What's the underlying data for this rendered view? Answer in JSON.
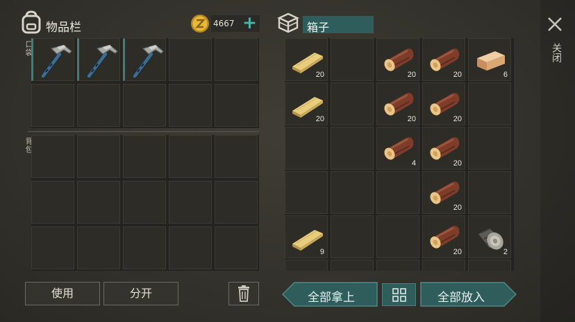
{
  "inventory": {
    "title": "物品栏",
    "pocket_label": "口袋",
    "backpack_label": "背包",
    "coins": "4667",
    "add_label": "+",
    "pocket_items": [
      "hammer",
      "hammer",
      "hammer"
    ]
  },
  "chest": {
    "title": "箱子",
    "rows": [
      [
        {
          "item": "plank",
          "qty": "20"
        },
        {
          "item": "",
          "qty": ""
        },
        {
          "item": "log",
          "qty": "20"
        },
        {
          "item": "log",
          "qty": "20"
        },
        {
          "item": "wood-block",
          "qty": "6"
        }
      ],
      [
        {
          "item": "plank",
          "qty": "20"
        },
        {
          "item": "",
          "qty": ""
        },
        {
          "item": "log",
          "qty": "20"
        },
        {
          "item": "log",
          "qty": "20"
        },
        {
          "item": "",
          "qty": ""
        }
      ],
      [
        {
          "item": "",
          "qty": ""
        },
        {
          "item": "",
          "qty": ""
        },
        {
          "item": "log",
          "qty": "4"
        },
        {
          "item": "log",
          "qty": "20"
        },
        {
          "item": "",
          "qty": ""
        }
      ],
      [
        {
          "item": "",
          "qty": ""
        },
        {
          "item": "",
          "qty": ""
        },
        {
          "item": "",
          "qty": ""
        },
        {
          "item": "log",
          "qty": "20"
        },
        {
          "item": "",
          "qty": ""
        }
      ],
      [
        {
          "item": "plank",
          "qty": "9"
        },
        {
          "item": "",
          "qty": ""
        },
        {
          "item": "",
          "qty": ""
        },
        {
          "item": "log",
          "qty": "20"
        },
        {
          "item": "stump",
          "qty": "2"
        }
      ]
    ]
  },
  "close_label": "关闭",
  "buttons": {
    "use": "使用",
    "split": "分开",
    "take_all": "全部拿上",
    "put_all": "全部放入"
  },
  "colors": {
    "accent": "#2f5d5c",
    "pocket_bar": "#3d7f7d",
    "coin": "#e0b437"
  }
}
